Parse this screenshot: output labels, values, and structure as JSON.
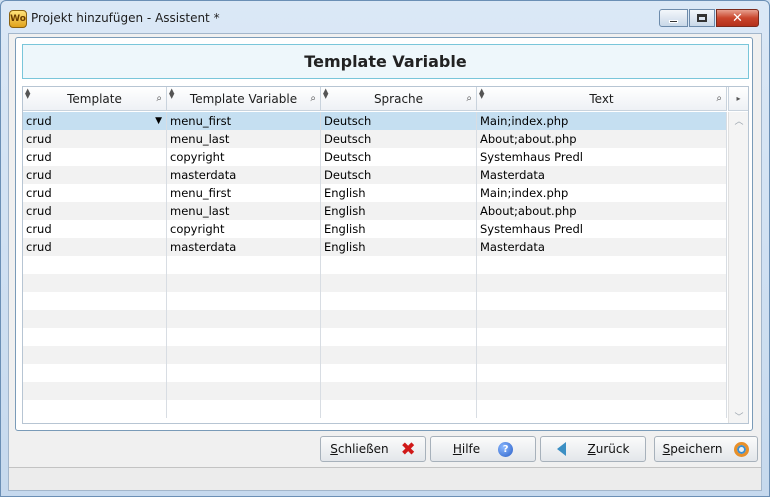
{
  "window": {
    "title": "Projekt hinzufügen - Assistent *",
    "app_icon_text": "Wo",
    "controls": {
      "minimize": "minimize",
      "maximize": "maximize",
      "close": "✕"
    }
  },
  "header": {
    "title": "Template Variable"
  },
  "grid": {
    "columns": [
      "Template",
      "Template Variable",
      "Sprache",
      "Text"
    ],
    "rows": [
      [
        "crud",
        "menu_first",
        "Deutsch",
        "Main;index.php"
      ],
      [
        "crud",
        "menu_last",
        "Deutsch",
        "About;about.php"
      ],
      [
        "crud",
        "copyright",
        "Deutsch",
        "Systemhaus Predl"
      ],
      [
        "crud",
        "masterdata",
        "Deutsch",
        "Masterdata"
      ],
      [
        "crud",
        "menu_first",
        "English",
        "Main;index.php"
      ],
      [
        "crud",
        "menu_last",
        "English",
        "About;about.php"
      ],
      [
        "crud",
        "copyright",
        "English",
        "Systemhaus Predl"
      ],
      [
        "crud",
        "masterdata",
        "English",
        "Masterdata"
      ]
    ],
    "selected_row": 0,
    "empty_rows": 9
  },
  "buttons": {
    "close": {
      "label_pre": "",
      "label_mnemonic": "S",
      "label_post": "chließen",
      "icon": "close-x-icon"
    },
    "help": {
      "label_pre": "",
      "label_mnemonic": "H",
      "label_post": "ilfe",
      "icon": "help-icon"
    },
    "back": {
      "label_pre": "",
      "label_mnemonic": "Z",
      "label_post": "urück",
      "icon": "back-arrow-icon"
    },
    "save": {
      "label_pre": "",
      "label_mnemonic": "S",
      "label_post": "peichern",
      "icon": "save-icon"
    }
  },
  "colors": {
    "selection": "#c5dff1",
    "header_border": "#79c6da",
    "close_icon": "#d01818",
    "back_icon": "#3b8fc4"
  }
}
